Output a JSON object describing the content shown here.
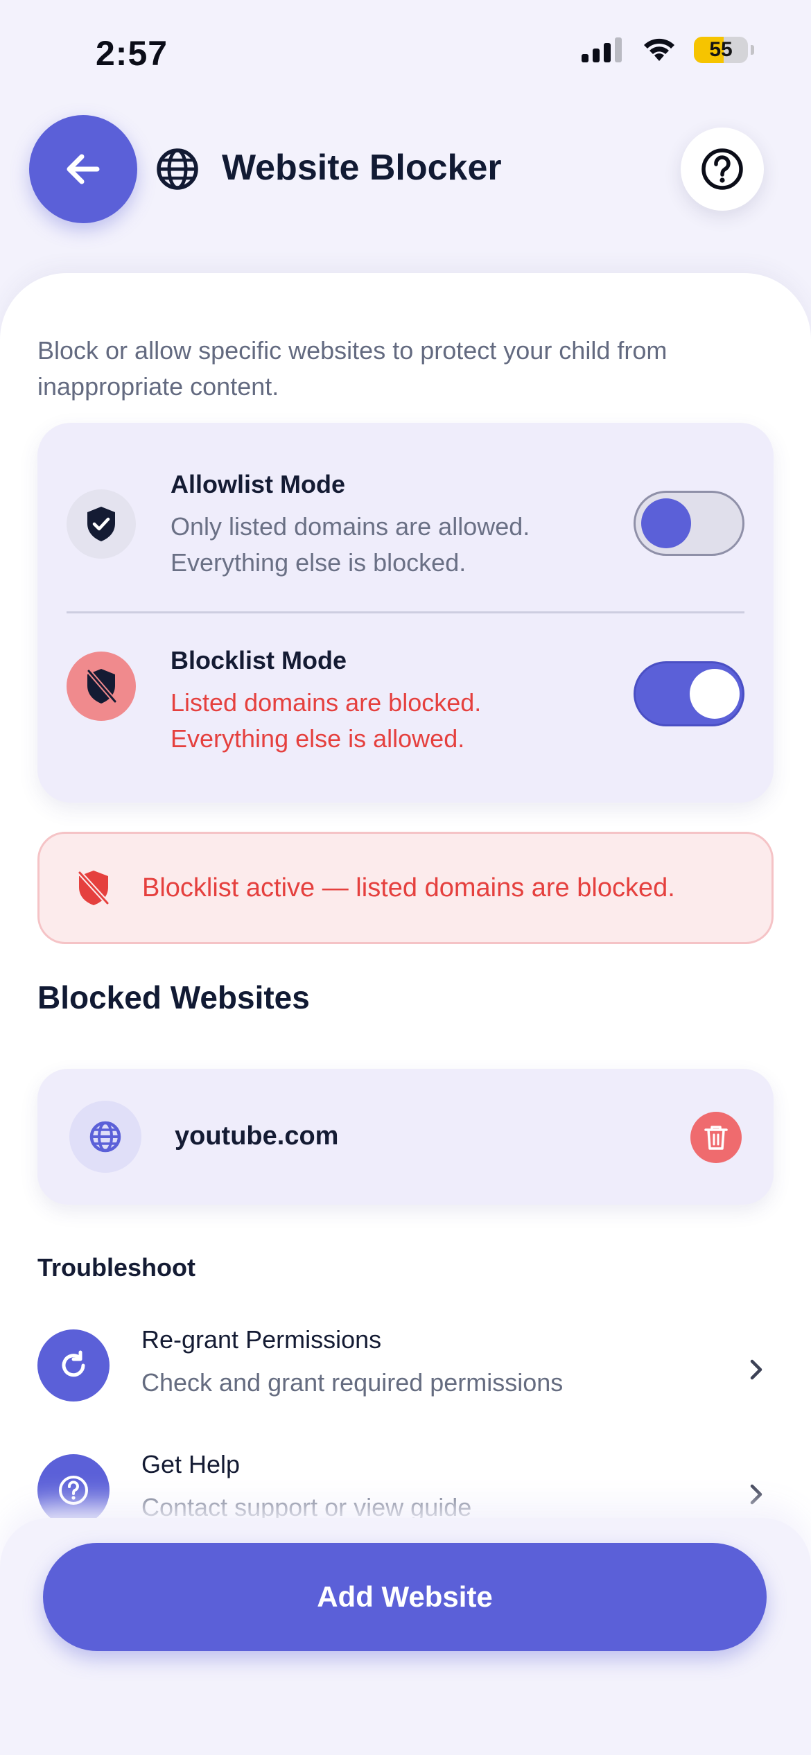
{
  "status_bar": {
    "time": "2:57",
    "battery": "55",
    "battery_level": 0.55
  },
  "header": {
    "title": "Website Blocker"
  },
  "intro": "Block or allow specific websites to protect your child from inappropriate content.",
  "modes": [
    {
      "title": "Allowlist Mode",
      "description": "Only listed domains are allowed. Everything else is blocked.",
      "enabled": false
    },
    {
      "title": "Blocklist Mode",
      "description": "Listed domains are blocked. Everything else is allowed.",
      "enabled": true
    }
  ],
  "alert": {
    "text": "Blocklist active — listed domains are blocked."
  },
  "blocked_section": {
    "title": "Blocked Websites",
    "sites": [
      {
        "domain": "youtube.com"
      }
    ]
  },
  "troubleshoot": {
    "title": "Troubleshoot",
    "items": [
      {
        "label": "Re-grant Permissions",
        "sublabel": "Check and grant required permissions"
      },
      {
        "label": "Get Help",
        "sublabel": "Contact support or view guide"
      }
    ]
  },
  "add_button": {
    "label": "Add Website"
  },
  "colors": {
    "accent": "#5b60d8",
    "danger": "#e5403e",
    "background": "#f3f2fc",
    "card": "#efedfb"
  }
}
